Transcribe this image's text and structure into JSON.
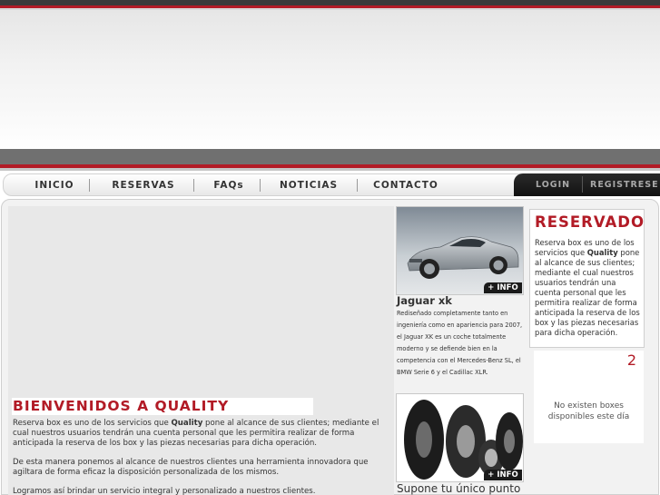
{
  "nav": {
    "items": [
      "INICIO",
      "RESERVAS",
      "FAQs",
      "NOTICIAS",
      "CONTACTO"
    ],
    "login": "LOGIN",
    "register": "REGISTRESE"
  },
  "main": {
    "title": "BIENVENIDOS A QUALITY",
    "p1_before": "Reserva box es uno de los servicios que ",
    "p1_bold": "Quality",
    "p1_after": " pone al alcance de sus clientes; mediante el cual nuestros usuarios tendrán una cuenta personal que les permitira realizar de forma anticipada la reserva de los box y las piezas necesarias para dicha operación.",
    "p2": "De esta manera ponemos al alcance de nuestros clientes una herramienta innovadora que agiltara de forma eficaz la disposición personalizada de los mismos.",
    "p3": "Logramos así brindar un servicio integral y personalizado a nuestros clientes."
  },
  "cars": [
    {
      "info_label": "+ INFO",
      "title": "Jaguar xk",
      "desc": "Rediseñado completamente tanto en ingeniería como en apariencia para 2007, el Jaguar XK es un coche totalmente moderno y se defiende bien en la competencia con el Mercedes-Benz SL, el BMW Serie 6 y el Cadillac XLR."
    },
    {
      "info_label": "+ INFO",
      "title": "Supone tu único punto"
    }
  ],
  "reservado": {
    "title": "RESERVADO",
    "text_before": "Reserva box es uno de los servicios que ",
    "text_bold": "Quality",
    "text_after": " pone al alcance de sus clientes; mediante el cual nuestros usuarios tendrán una cuenta personal que les permitira realizar de forma anticipada la reserva de los box y las piezas necesarias para dicha operación."
  },
  "calendar": {
    "number": "2",
    "message": "No existen boxes disponibles este día"
  },
  "colors": {
    "accent_red": "#b21b26",
    "dark": "#1a1a1a"
  }
}
